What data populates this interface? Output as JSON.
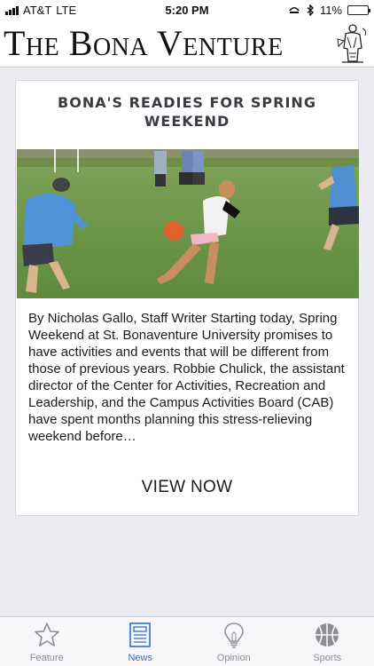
{
  "status_bar": {
    "carrier": "AT&T",
    "network": "LTE",
    "time": "5:20 PM",
    "battery_percent": "11%",
    "battery_level": 0.11
  },
  "masthead": {
    "title": "The Bona Venture",
    "logo_icon": "newspaper-mascot-logo"
  },
  "article": {
    "title": "Bona's Readies for Spring Weekend",
    "photo": "students-playing-kickball-photo",
    "excerpt": " By Nicholas Gallo, Staff Writer Starting today, Spring Weekend at St. Bonaventure University promises to have activities and events that will be different from those of previous years. Robbie Chulick, the assistant director of the Center for Activities, Recreation and Leadership, and the Campus Activities Board (CAB) have spent months planning this stress-relieving weekend before…",
    "button_label": "VIEW NOW"
  },
  "tabs": [
    {
      "label": "Feature",
      "icon": "star-icon",
      "active": false
    },
    {
      "label": "News",
      "icon": "newspaper-icon",
      "active": true
    },
    {
      "label": "Opinion",
      "icon": "lightbulb-icon",
      "active": false
    },
    {
      "label": "Sports",
      "icon": "basketball-icon",
      "active": false
    }
  ],
  "colors": {
    "active_tab": "#2f6fd6",
    "inactive_tab": "#8e8e93",
    "background": "#ecebf1",
    "battery": "#f2c400"
  }
}
